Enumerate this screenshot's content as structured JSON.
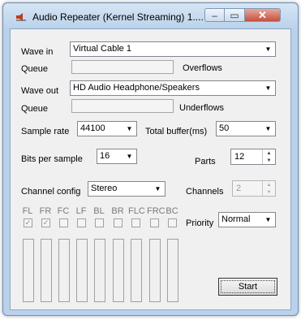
{
  "window": {
    "title": "Audio Repeater (Kernel Streaming) 1....",
    "minimize": "–",
    "maximize": "▭",
    "close": "✕"
  },
  "wave_in": {
    "label": "Wave in",
    "value": "Virtual Cable 1"
  },
  "queue_in": {
    "label": "Queue",
    "status_label": "Overflows"
  },
  "wave_out": {
    "label": "Wave out",
    "value": "HD Audio Headphone/Speakers"
  },
  "queue_out": {
    "label": "Queue",
    "status_label": "Underflows"
  },
  "sample_rate": {
    "label": "Sample rate",
    "value": "44100"
  },
  "total_buffer": {
    "label": "Total buffer(ms)",
    "value": "50"
  },
  "bits_per_sample": {
    "label": "Bits per sample",
    "value": "16"
  },
  "parts": {
    "label": "Parts",
    "value": "12"
  },
  "channel_config": {
    "label": "Channel config",
    "value": "Stereo"
  },
  "channels": {
    "label": "Channels",
    "value": "2"
  },
  "priority": {
    "label": "Priority",
    "value": "Normal"
  },
  "channel_labels": [
    "FL",
    "FR",
    "FC",
    "LF",
    "BL",
    "BR",
    "FLC",
    "FRC",
    "BC"
  ],
  "channel_checked": [
    true,
    true,
    false,
    false,
    false,
    false,
    false,
    false,
    false
  ],
  "start_button": "Start",
  "icons": {
    "combo_arrow": "▼",
    "spin_up": "▲",
    "spin_down": "▼",
    "check": "✓"
  }
}
